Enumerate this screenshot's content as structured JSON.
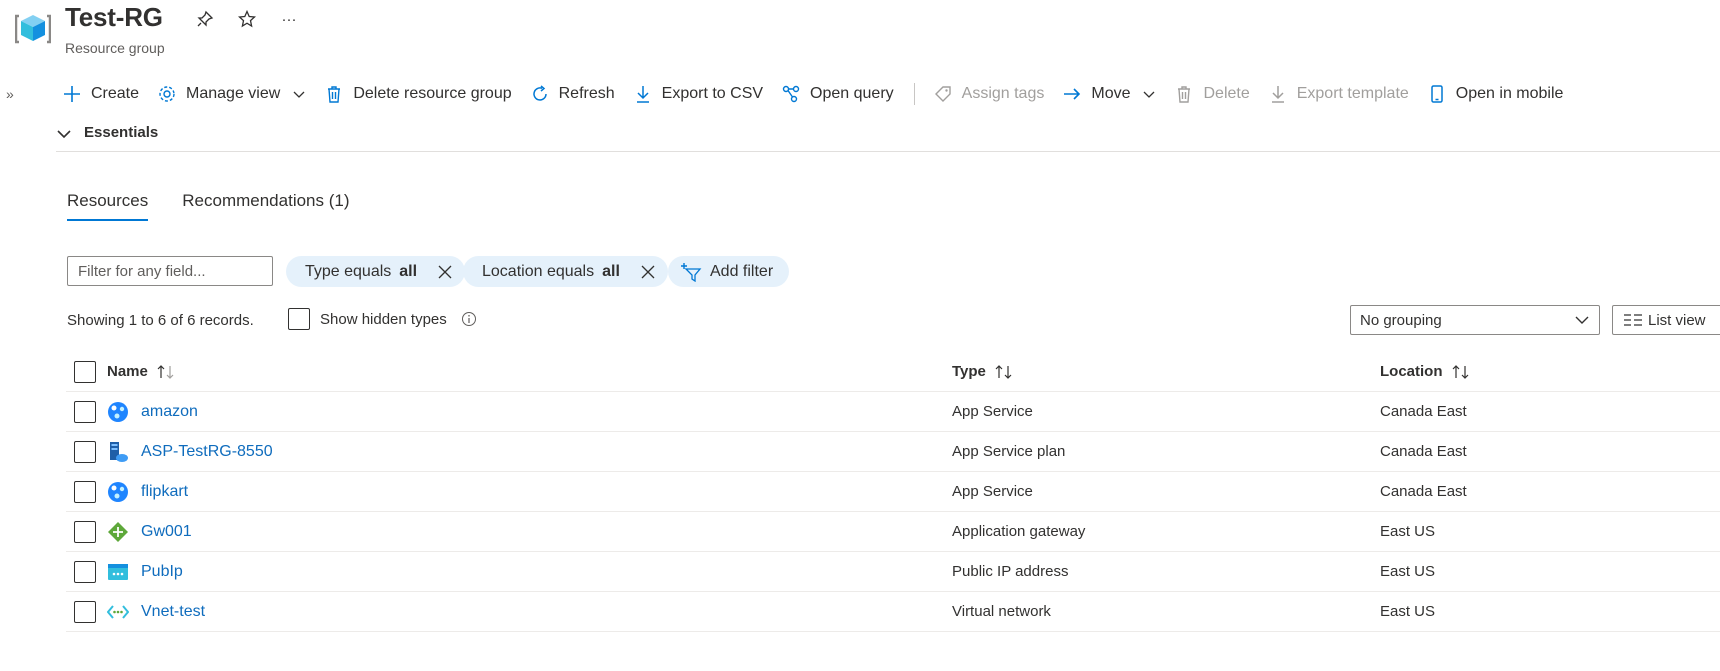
{
  "header": {
    "title": "Test-RG",
    "subtitle": "Resource group",
    "more_label": "···"
  },
  "toolbar": {
    "create": "Create",
    "manage_view": "Manage view",
    "delete_rg": "Delete resource group",
    "refresh": "Refresh",
    "export_csv": "Export to CSV",
    "open_query": "Open query",
    "assign_tags": "Assign tags",
    "move": "Move",
    "delete": "Delete",
    "export_template": "Export template",
    "open_mobile": "Open in mobile"
  },
  "essentials": {
    "label": "Essentials"
  },
  "tabs": [
    {
      "label": "Resources",
      "active": true
    },
    {
      "label": "Recommendations (1)",
      "active": false
    }
  ],
  "filters": {
    "search_placeholder": "Filter for any field...",
    "type_pill_prefix": "Type equals",
    "type_pill_value": "all",
    "location_pill_prefix": "Location equals",
    "location_pill_value": "all",
    "add_filter": "Add filter"
  },
  "records_text": "Showing 1 to 6 of 6 records.",
  "show_hidden_label": "Show hidden types",
  "grouping": {
    "selected": "No grouping"
  },
  "view": {
    "label": "List view"
  },
  "table": {
    "columns": {
      "name": "Name",
      "type": "Type",
      "location": "Location"
    },
    "rows": [
      {
        "name": "amazon",
        "type": "App Service",
        "location": "Canada East",
        "icon": "app-service-icon"
      },
      {
        "name": "ASP-TestRG-8550",
        "type": "App Service plan",
        "location": "Canada East",
        "icon": "app-service-plan-icon"
      },
      {
        "name": "flipkart",
        "type": "App Service",
        "location": "Canada East",
        "icon": "app-service-icon"
      },
      {
        "name": "Gw001",
        "type": "Application gateway",
        "location": "East US",
        "icon": "application-gateway-icon"
      },
      {
        "name": "PubIp",
        "type": "Public IP address",
        "location": "East US",
        "icon": "public-ip-icon"
      },
      {
        "name": "Vnet-test",
        "type": "Virtual network",
        "location": "East US",
        "icon": "virtual-network-icon"
      }
    ]
  },
  "colors": {
    "accent": "#0078d4",
    "link": "#0f6cbd",
    "pill_bg": "#e5f1fb"
  }
}
